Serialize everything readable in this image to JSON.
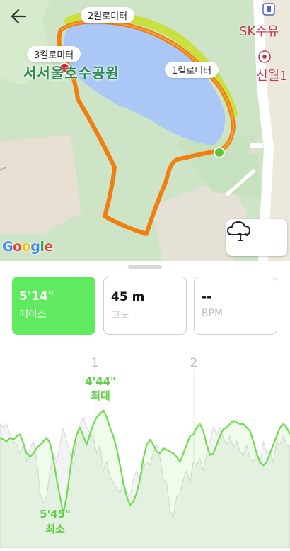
{
  "map": {
    "km_labels": [
      "2킬로미터",
      "3킬로미터",
      "1킬로미터"
    ],
    "park_name": "서서울호수공원",
    "poi": [
      "SK주유",
      "신월1"
    ],
    "google": "Google",
    "colors": {
      "route": "#f07e10",
      "start": "#5ec934",
      "end": "#d4141f",
      "lake": "#aac7f5"
    }
  },
  "weather": {
    "temperature": "1°",
    "icon": "cloud-icon"
  },
  "metrics": [
    {
      "value": "5'14\"",
      "label": "페이스",
      "active": true
    },
    {
      "value": "45 m",
      "label": "고도",
      "active": false
    },
    {
      "value": "--",
      "label": "BPM",
      "active": false
    }
  ],
  "chart_data": {
    "type": "line",
    "x_ticks": [
      "1",
      "2"
    ],
    "annotations": [
      {
        "value": "4'44\"",
        "label": "최대"
      },
      {
        "value": "5'45\"",
        "label": "최소"
      }
    ],
    "series": [
      {
        "values": [
          0.64,
          0.63,
          0.62,
          0.64,
          0.63,
          0.65,
          0.66,
          0.61,
          0.55,
          0.53,
          0.55,
          0.58,
          0.6,
          0.62,
          0.64,
          0.61,
          0.52,
          0.4,
          0.3,
          0.2,
          0.3,
          0.45,
          0.58,
          0.66,
          0.7,
          0.65,
          0.6,
          0.66,
          0.72,
          0.76,
          0.78,
          0.8,
          0.76,
          0.7,
          0.65,
          0.58,
          0.48,
          0.38,
          0.3,
          0.25,
          0.27,
          0.32,
          0.4,
          0.52,
          0.6,
          0.63,
          0.6,
          0.56,
          0.55,
          0.58,
          0.57,
          0.56,
          0.55,
          0.53,
          0.5,
          0.55,
          0.6,
          0.65,
          0.66,
          0.7,
          0.72,
          0.68,
          0.6,
          0.54,
          0.55,
          0.6,
          0.65,
          0.69,
          0.7,
          0.72,
          0.74,
          0.73,
          0.72,
          0.72,
          0.7,
          0.68,
          0.62,
          0.55,
          0.5,
          0.48,
          0.5,
          0.55,
          0.6,
          0.65,
          0.7,
          0.72,
          0.7,
          0.66
        ]
      },
      {
        "values": [
          0.72,
          0.7,
          0.72,
          0.66,
          0.62,
          0.6,
          0.55,
          0.6,
          0.5,
          0.58,
          0.62,
          0.52,
          0.32,
          0.26,
          0.3,
          0.45,
          0.55,
          0.5,
          0.6,
          0.7,
          0.62,
          0.55,
          0.48,
          0.66,
          0.72,
          0.76,
          0.7,
          0.67,
          0.64,
          0.55,
          0.6,
          0.45,
          0.5,
          0.42,
          0.38,
          0.35,
          0.32,
          0.38,
          0.33,
          0.3,
          0.4,
          0.45,
          0.38,
          0.47,
          0.5,
          0.48,
          0.56,
          0.6,
          0.52,
          0.4,
          0.38,
          0.22,
          0.18,
          0.3,
          0.32,
          0.4,
          0.45,
          0.38,
          0.5,
          0.48,
          0.52,
          0.45,
          0.55,
          0.62,
          0.7,
          0.66,
          0.7,
          0.64,
          0.6,
          0.65,
          0.58,
          0.62,
          0.56,
          0.54,
          0.6,
          0.52,
          0.5,
          0.55,
          0.48,
          0.62,
          0.55,
          0.56,
          0.5,
          0.62,
          0.6,
          0.65,
          0.6,
          0.6
        ]
      }
    ]
  }
}
